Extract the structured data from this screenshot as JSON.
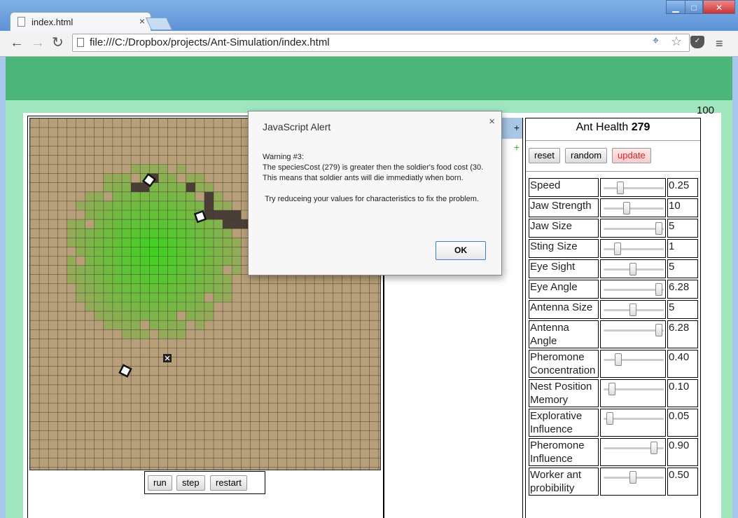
{
  "browser": {
    "tab_title": "index.html",
    "url": "file:///C:/Dropbox/projects/Ant-Simulation/index.html",
    "window_controls": [
      "minimize",
      "maximize",
      "close"
    ]
  },
  "page": {
    "counter": "100",
    "controls": {
      "run": "run",
      "step": "step",
      "restart": "restart"
    },
    "species_list": {
      "add_label": "+",
      "add_label_2": "+"
    },
    "panel": {
      "health_label": "Ant Health",
      "health_value": "279",
      "buttons": {
        "reset": "reset",
        "random": "random",
        "update": "update"
      },
      "params": [
        {
          "name": "Speed",
          "value": "0.25",
          "level": 0.25
        },
        {
          "name": "Jaw Strength",
          "value": "10",
          "level": 0.38
        },
        {
          "name": "Jaw Size",
          "value": "5",
          "level": 1.0
        },
        {
          "name": "Sting Size",
          "value": "1",
          "level": 0.2
        },
        {
          "name": "Eye Sight",
          "value": "5",
          "level": 0.5
        },
        {
          "name": "Eye Angle",
          "value": "6.28",
          "level": 1.0
        },
        {
          "name": "Antenna Size",
          "value": "5",
          "level": 0.5
        },
        {
          "name": "Antenna Angle",
          "value": "6.28",
          "level": 1.0
        },
        {
          "name": "Pheromone Concentration",
          "value": "0.40",
          "level": 0.22
        },
        {
          "name": "Nest Position Memory",
          "value": "0.10",
          "level": 0.1
        },
        {
          "name": "Explorative Influence",
          "value": "0.05",
          "level": 0.05
        },
        {
          "name": "Pheromone Influence",
          "value": "0.90",
          "level": 0.9
        },
        {
          "name": "Worker ant probibility",
          "value": "0.50",
          "level": 0.5
        }
      ]
    }
  },
  "dialog": {
    "title": "JavaScript Alert",
    "message": "Warning #3:\nThe speciesCost (279) is greater then the soldier's food cost (30. This means that soldier ants will die immediatly when born.\n\n Try reduceing your values for characteristics to fix the problem.",
    "ok_label": "OK"
  },
  "colors": {
    "header_green": "#4cb67a",
    "page_bg": "#9fe6bf",
    "ground": "#b79f7a",
    "pheromone_green": "#3fd11a",
    "nest_path": "#4a3e36",
    "update_red": "#d22222"
  }
}
